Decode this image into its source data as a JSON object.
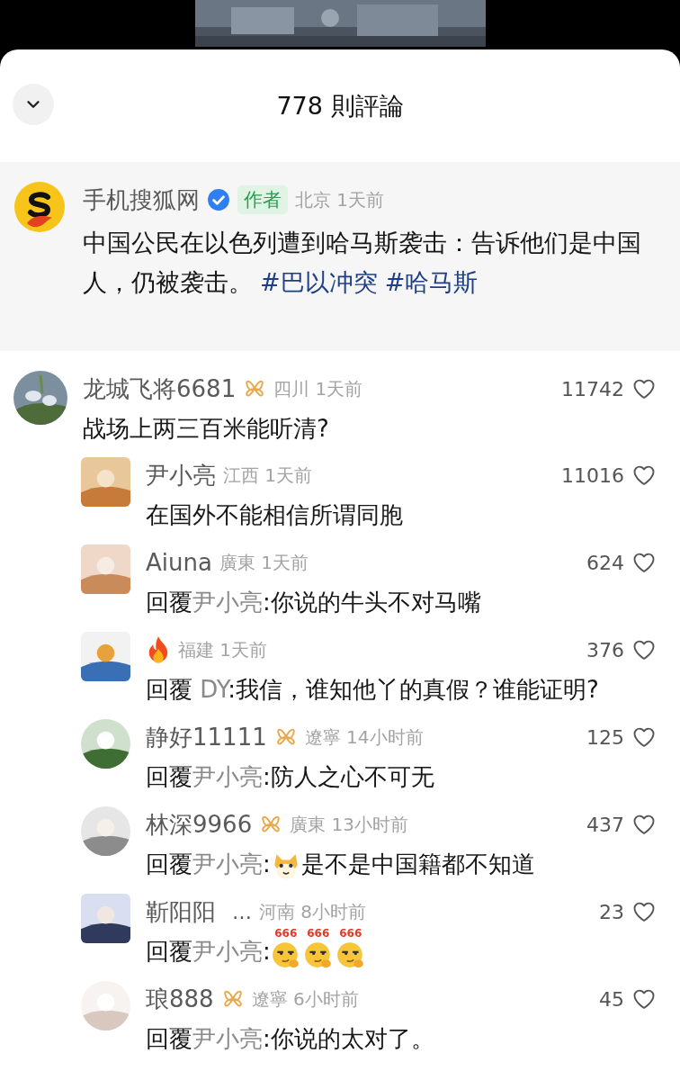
{
  "header": {
    "title": "778 則評論"
  },
  "post": {
    "author": "手机搜狐网",
    "verified": true,
    "tag": "作者",
    "location": "北京",
    "time": "1天前",
    "text": [
      {
        "kind": "text",
        "text": "中国公民在以色列遭到哈马斯袭击：告诉他们是中国人，仍被袭击。"
      },
      {
        "kind": "hashtag",
        "text": "#巴以冲突"
      },
      {
        "kind": "hashtag",
        "text": "#哈马斯"
      }
    ]
  },
  "comments": [
    {
      "name": "龙城飞将6681",
      "badge": true,
      "location": "四川",
      "time": "1天前",
      "likes": "11742",
      "text": [
        {
          "kind": "text",
          "text": "战场上两三百米能听清?"
        }
      ],
      "children": [
        {
          "kind": "user",
          "name": "尹小亮",
          "badge": false,
          "location": "江西",
          "time": "1天前",
          "likes": "11016",
          "text": [
            {
              "kind": "text",
              "text": "在国外不能相信所谓同胞"
            }
          ]
        },
        {
          "kind": "user",
          "name": "Aiuna",
          "badge": false,
          "location": "廣東",
          "time": "1天前",
          "likes": "624",
          "text": [
            {
              "kind": "text",
              "text": "回覆"
            },
            {
              "kind": "mention",
              "text": "尹小亮"
            },
            {
              "kind": "text",
              "text": ":你说的牛头不对马嘴"
            }
          ]
        },
        {
          "kind": "fire-user",
          "badge": false,
          "location": "福建",
          "time": "1天前",
          "likes": "376",
          "text": [
            {
              "kind": "text",
              "text": "回覆 "
            },
            {
              "kind": "mention",
              "text": "DY"
            },
            {
              "kind": "text",
              "text": ":我信，谁知他丫的真假？谁能证明?"
            }
          ]
        },
        {
          "kind": "user",
          "name": "静好11111",
          "badge": true,
          "location": "遼寧",
          "time": "14小时前",
          "likes": "125",
          "text": [
            {
              "kind": "text",
              "text": "回覆"
            },
            {
              "kind": "mention",
              "text": "尹小亮"
            },
            {
              "kind": "text",
              "text": ":防人之心不可无"
            }
          ]
        },
        {
          "kind": "user",
          "name": "林深9966",
          "badge": true,
          "location": "廣東",
          "time": "13小时前",
          "likes": "437",
          "text": [
            {
              "kind": "text",
              "text": "回覆"
            },
            {
              "kind": "mention",
              "text": "尹小亮"
            },
            {
              "kind": "text",
              "text": ":"
            },
            {
              "kind": "doge"
            },
            {
              "kind": "text",
              "text": "是不是中国籍都不知道"
            }
          ]
        },
        {
          "kind": "user",
          "name": "靳阳阳",
          "name_extra": "…",
          "badge": false,
          "location": "河南",
          "time": "8小时前",
          "likes": "23",
          "text": [
            {
              "kind": "text",
              "text": "回覆"
            },
            {
              "kind": "mention",
              "text": "尹小亮"
            },
            {
              "kind": "text",
              "text": ":"
            },
            {
              "kind": "smirk",
              "label": "666"
            },
            {
              "kind": "smirk",
              "label": "666"
            },
            {
              "kind": "smirk",
              "label": "666"
            }
          ]
        },
        {
          "kind": "user",
          "name": "琅888",
          "badge": true,
          "location": "遼寧",
          "time": "6小时前",
          "likes": "45",
          "text": [
            {
              "kind": "text",
              "text": "回覆"
            },
            {
              "kind": "mention",
              "text": "尹小亮"
            },
            {
              "kind": "text",
              "text": ":你说的太对了。"
            }
          ]
        }
      ]
    }
  ]
}
